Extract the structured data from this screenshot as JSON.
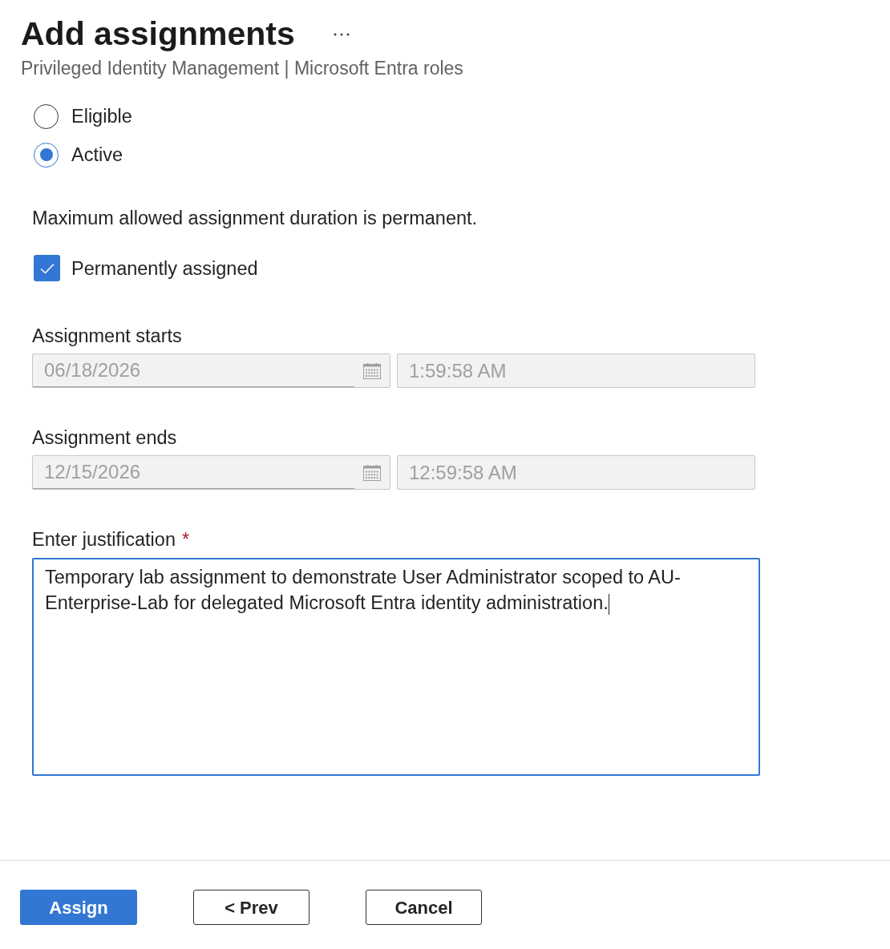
{
  "header": {
    "title": "Add assignments",
    "subtitle": "Privileged Identity Management | Microsoft Entra roles"
  },
  "assignment_type": {
    "options": [
      {
        "label": "Eligible",
        "selected": false
      },
      {
        "label": "Active",
        "selected": true
      }
    ]
  },
  "duration_note": "Maximum allowed assignment duration is permanent.",
  "permanent": {
    "label": "Permanently assigned",
    "checked": true
  },
  "assignment_starts": {
    "label": "Assignment starts",
    "date": "06/18/2026",
    "time": "1:59:58 AM",
    "disabled": true
  },
  "assignment_ends": {
    "label": "Assignment ends",
    "date": "12/15/2026",
    "time": "12:59:58 AM",
    "disabled": true
  },
  "justification": {
    "label": "Enter justification",
    "required_mark": "*",
    "value": "Temporary lab assignment to demonstrate User Administrator scoped to AU-Enterprise-Lab for delegated Microsoft Entra identity administration.",
    "focused": true
  },
  "buttons": [
    {
      "label": "Assign",
      "kind": "primary"
    },
    {
      "label": "< Prev",
      "kind": "secondary"
    },
    {
      "label": "Cancel",
      "kind": "secondary"
    }
  ]
}
